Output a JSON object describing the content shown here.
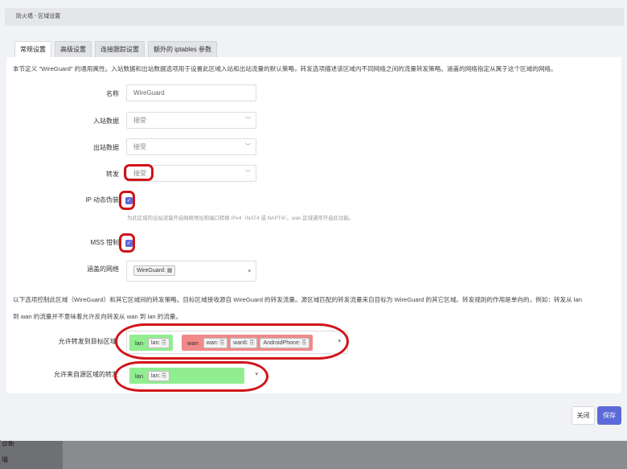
{
  "backdrop": {
    "nav_items": [
      "诊断",
      "墙"
    ]
  },
  "modal": {
    "title": "防火墙 - 区域设置"
  },
  "tabs": [
    {
      "label": "常规设置",
      "active": true
    },
    {
      "label": "高级设置",
      "active": false
    },
    {
      "label": "连接跟踪设置",
      "active": false
    },
    {
      "label": "额外的 iptables 参数",
      "active": false
    }
  ],
  "general": {
    "description": "本节定义 \"WireGuard\" 的通用属性。入站数据和出站数据选项用于设置此区域入站和出站流量的默认策略，转发选项描述该区域内不同网络之间的流量转发策略。涵盖的网络指定从属于这个区域的网络。",
    "name": {
      "label": "名称",
      "value": "WireGuard"
    },
    "input": {
      "label": "入站数据",
      "value": "接受"
    },
    "output": {
      "label": "出站数据",
      "value": "接受"
    },
    "forward": {
      "label": "转发",
      "value": "接受"
    },
    "masq": {
      "label": "IP 动态伪装",
      "checked": true,
      "help": "为此区域的出站流量开启网络地址和端口转换 IPv4（NAT4 或 NAPT4），wan 区域通常开启此功能。"
    },
    "mtu_fix": {
      "label": "MSS 钳制",
      "checked": true
    },
    "networks": {
      "label": "涵盖的网络",
      "value": "WireGuard:"
    }
  },
  "forwarding": {
    "description_line1": "以下选项控制此区域（WireGuard）和其它区域间的转发策略。目标区域接收源自 WireGuard 的转发流量。源区域匹配的转发流量来自目标为 WireGuard 的其它区域。转发规则的作用是单向的，例如：转发从 lan",
    "description_line2": "到 wan 的流量并不意味着允许反向转发从 wan 到 lan 的流量。",
    "to_dest": {
      "label": "允许转发到目标区域:",
      "zones": [
        {
          "name": "lan",
          "color": "#90ee90",
          "interfaces": [
            "lan:"
          ]
        },
        {
          "name": "wan",
          "color": "#f08a8a",
          "interfaces": [
            "wan:",
            "wan6:",
            "AndroidPhone:"
          ]
        }
      ]
    },
    "from_src": {
      "label": "允许来自源区域的转发",
      "zones": [
        {
          "name": "lan",
          "color": "#90ee90",
          "interfaces": [
            "lan:"
          ]
        }
      ]
    }
  },
  "buttons": {
    "close": "关闭",
    "save": "保存"
  },
  "icons": {
    "checkbox": "check-icon",
    "dropdown": "chevron-down-icon",
    "interface": "network-interface-icon"
  },
  "colors": {
    "accent": "#5b6ad8",
    "annotation": "#d01418"
  }
}
